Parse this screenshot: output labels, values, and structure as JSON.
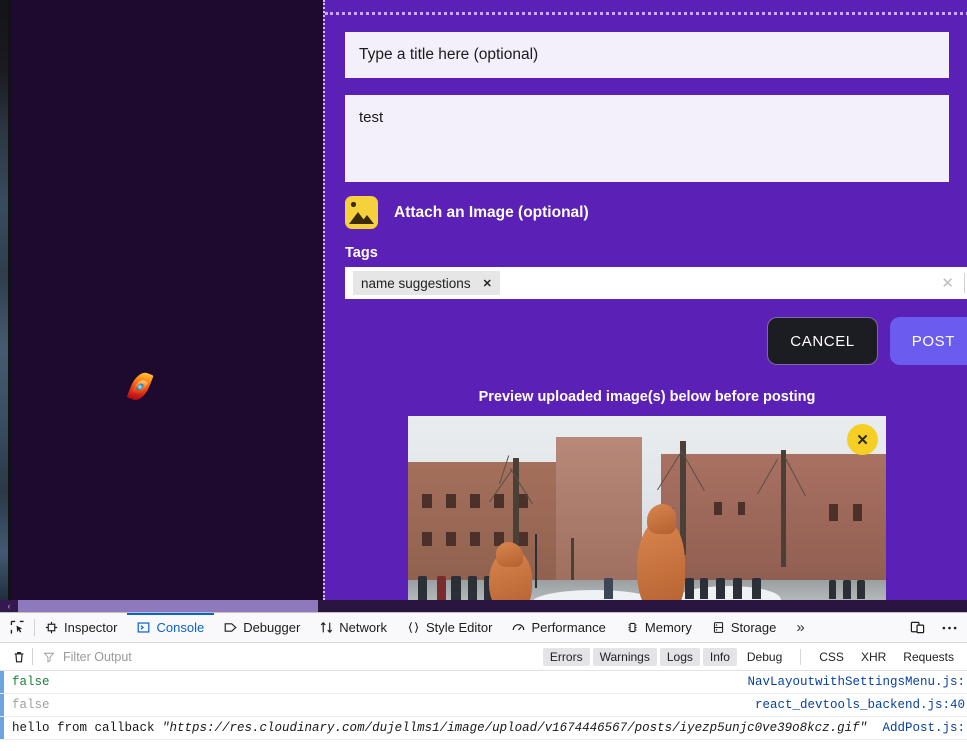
{
  "modal": {
    "title_placeholder": "Type a title here (optional)",
    "body_value": "test",
    "attach_label": "Attach an Image (optional)",
    "attach_icon": "image-icon",
    "tags_label": "Tags",
    "tags": [
      {
        "label": "name suggestions",
        "remove": "✕"
      }
    ],
    "tags_input_value": "",
    "tags_clear": "✕",
    "cancel_label": "CANCEL",
    "post_label": "POST",
    "preview_caption": "Preview uploaded image(s) below before posting",
    "preview_close": "✕",
    "accent_purple": "#5b21b6",
    "accent_post": "#6b5cf0",
    "accent_yellow": "#f5cf23"
  },
  "page": {
    "background_color": "#1d0a2e",
    "spinner_icon": "flame-spinner-icon",
    "hscroll_left_arrow": "‹"
  },
  "devtools": {
    "picker_icon": "element-picker-icon",
    "tabs": [
      {
        "label": "Inspector",
        "icon": "inspector-icon",
        "active": false
      },
      {
        "label": "Console",
        "icon": "console-icon",
        "active": true
      },
      {
        "label": "Debugger",
        "icon": "debugger-icon",
        "active": false
      },
      {
        "label": "Network",
        "icon": "network-icon",
        "active": false
      },
      {
        "label": "Style Editor",
        "icon": "style-editor-icon",
        "active": false
      },
      {
        "label": "Performance",
        "icon": "performance-icon",
        "active": false
      },
      {
        "label": "Memory",
        "icon": "memory-icon",
        "active": false
      },
      {
        "label": "Storage",
        "icon": "storage-icon",
        "active": false
      }
    ],
    "overflow_icon": "»",
    "responsive_icon": "responsive-design-mode-icon",
    "meatball_icon": "more-options-icon",
    "trash_icon": "clear-console-icon",
    "filter_icon": "filter-icon",
    "filter_placeholder": "Filter Output",
    "filter_value": "",
    "filter_pills": [
      {
        "label": "Errors",
        "active": true
      },
      {
        "label": "Warnings",
        "active": true
      },
      {
        "label": "Logs",
        "active": true
      },
      {
        "label": "Info",
        "active": true
      },
      {
        "label": "Debug",
        "active": false
      }
    ],
    "request_pills": [
      {
        "label": "CSS",
        "active": false
      },
      {
        "label": "XHR",
        "active": false
      },
      {
        "label": "Requests",
        "active": false
      }
    ],
    "rows": [
      {
        "message": "false",
        "style": "m-false-green",
        "source": "NavLayoutwithSettingsMenu.js:"
      },
      {
        "message": "false",
        "style": "m-false-grey",
        "source": "react_devtools_backend.js:40"
      },
      {
        "message_prefix": "hello from callback ",
        "message_string": "\"https://res.cloudinary.com/dujellms1/image/upload/v1674446567/posts/iyezp5unjc0ve39o8kcz.gif\"",
        "style": "m-plain",
        "source": "AddPost.js:"
      }
    ]
  }
}
